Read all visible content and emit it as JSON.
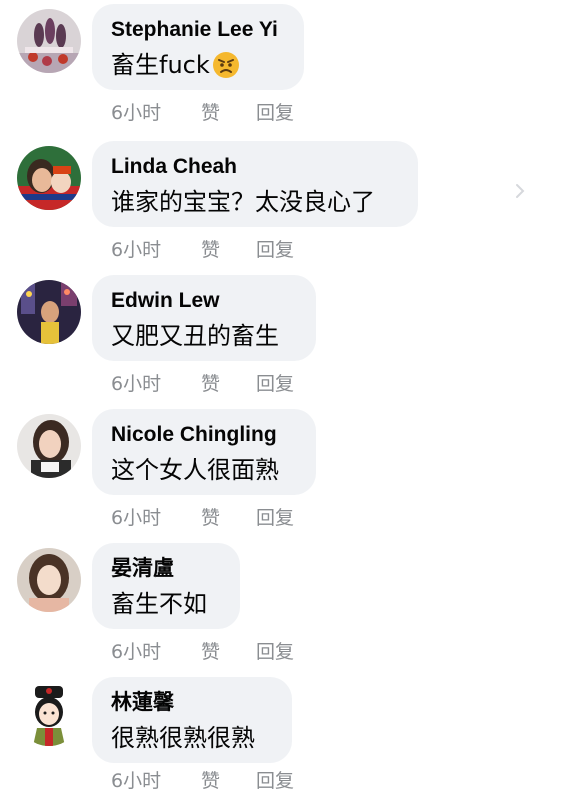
{
  "comments": [
    {
      "author": "Stephanie Lee Yi",
      "text": "畜生fuck",
      "emoji": "angry-face-icon",
      "time": "6小时",
      "like": "赞",
      "reply": "回复"
    },
    {
      "author": "Linda Cheah",
      "text": "谁家的宝宝？太没良心了",
      "time": "6小时",
      "like": "赞",
      "reply": "回复"
    },
    {
      "author": "Edwin Lew",
      "text": "又肥又丑的畜生",
      "time": "6小时",
      "like": "赞",
      "reply": "回复"
    },
    {
      "author": "Nicole Chingling",
      "text": "这个女人很面熟",
      "time": "6小时",
      "like": "赞",
      "reply": "回复"
    },
    {
      "author": "晏清盧",
      "text": "畜生不如",
      "time": "6小时",
      "like": "赞",
      "reply": "回复"
    },
    {
      "author": "林蓮馨",
      "text": "很熟很熟很熟",
      "time": "6小时",
      "like": "赞",
      "reply": "回复"
    }
  ],
  "colors": {
    "bubble": "#f0f2f5",
    "text": "#050505",
    "meta": "#8a8d91"
  }
}
